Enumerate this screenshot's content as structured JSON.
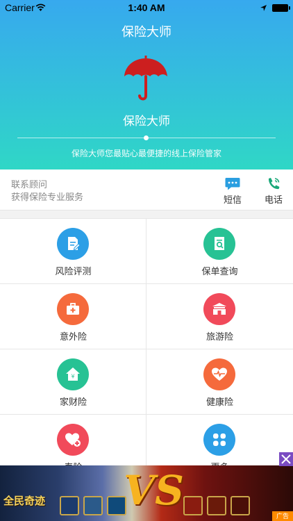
{
  "status_bar": {
    "carrier": "Carrier",
    "time": "1:40 AM"
  },
  "header": {
    "title": "保险大师",
    "brand": "保险大师",
    "slogan": "保险大师您最贴心最便捷的线上保险管家"
  },
  "contact": {
    "line1": "联系顾问",
    "line2": "获得保险专业服务",
    "sms_label": "短信",
    "phone_label": "电话"
  },
  "grid": {
    "items": [
      {
        "label": "风险评测",
        "icon": "document-edit-icon",
        "color": "#2c9fe6"
      },
      {
        "label": "保单查询",
        "icon": "document-search-icon",
        "color": "#27c294"
      },
      {
        "label": "意外险",
        "icon": "medical-kit-icon",
        "color": "#f56a3c"
      },
      {
        "label": "旅游险",
        "icon": "gate-icon",
        "color": "#f14a5a"
      },
      {
        "label": "家财险",
        "icon": "house-yen-icon",
        "color": "#27c294"
      },
      {
        "label": "健康险",
        "icon": "heart-pulse-icon",
        "color": "#f56a3c"
      },
      {
        "label": "寿险",
        "icon": "heart-plus-icon",
        "color": "#f14a5a"
      },
      {
        "label": "更多",
        "icon": "grid-more-icon",
        "color": "#2c9fe6"
      }
    ]
  },
  "ad": {
    "game_title": "全民奇迹",
    "vs_text": "VS",
    "badge": "广告"
  },
  "colors": {
    "umbrella": "#cc1f1f",
    "hero_top": "#37a9ee",
    "hero_bottom": "#2fd7c6"
  }
}
